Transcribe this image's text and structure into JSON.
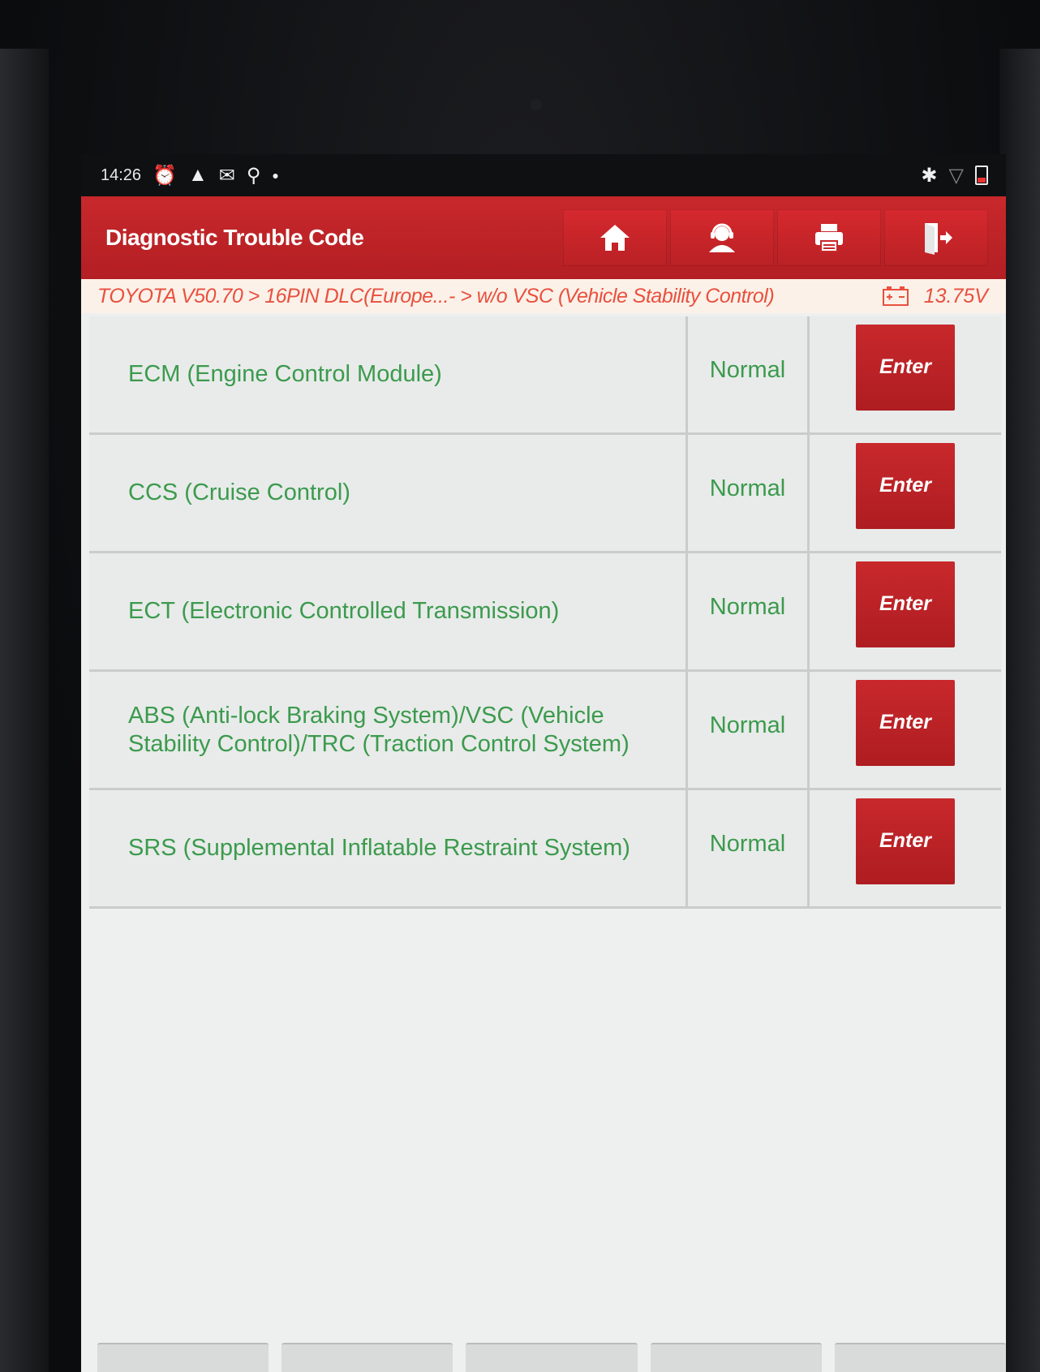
{
  "status_bar": {
    "time": "14:26",
    "left_icons": [
      "alarm-icon",
      "warning-icon",
      "mail-icon",
      "usb-icon",
      "dot-icon"
    ],
    "right_icons": [
      "bluetooth-icon",
      "wifi-icon",
      "battery-icon"
    ]
  },
  "header": {
    "title": "Diagnostic Trouble Code",
    "toolbar": [
      {
        "name": "home-button",
        "icon": "home-icon"
      },
      {
        "name": "support-button",
        "icon": "headset-user-icon"
      },
      {
        "name": "print-button",
        "icon": "printer-icon"
      },
      {
        "name": "exit-button",
        "icon": "exit-door-icon"
      }
    ]
  },
  "breadcrumb": {
    "path": "TOYOTA V50.70 > 16PIN DLC(Europe...- > w/o VSC (Vehicle Stability Control)",
    "battery_icon": "car-battery-icon",
    "voltage": "13.75V"
  },
  "systems": [
    {
      "name": "ECM (Engine Control Module)",
      "status": "Normal",
      "action": "Enter"
    },
    {
      "name": "CCS (Cruise Control)",
      "status": "Normal",
      "action": "Enter"
    },
    {
      "name": "ECT (Electronic Controlled Transmission)",
      "status": "Normal",
      "action": "Enter"
    },
    {
      "name": "ABS (Anti-lock Braking System)/VSC (Vehicle Stability Control)/TRC (Traction Control System)",
      "status": "Normal",
      "action": "Enter"
    },
    {
      "name": "SRS (Supplemental Inflatable Restraint System)",
      "status": "Normal",
      "action": "Enter"
    }
  ],
  "colors": {
    "header_red": "#c8282c",
    "row_text_green": "#3c9a4d",
    "breadcrumb_text": "#e9503f",
    "breadcrumb_bg": "#fbf1e8"
  }
}
